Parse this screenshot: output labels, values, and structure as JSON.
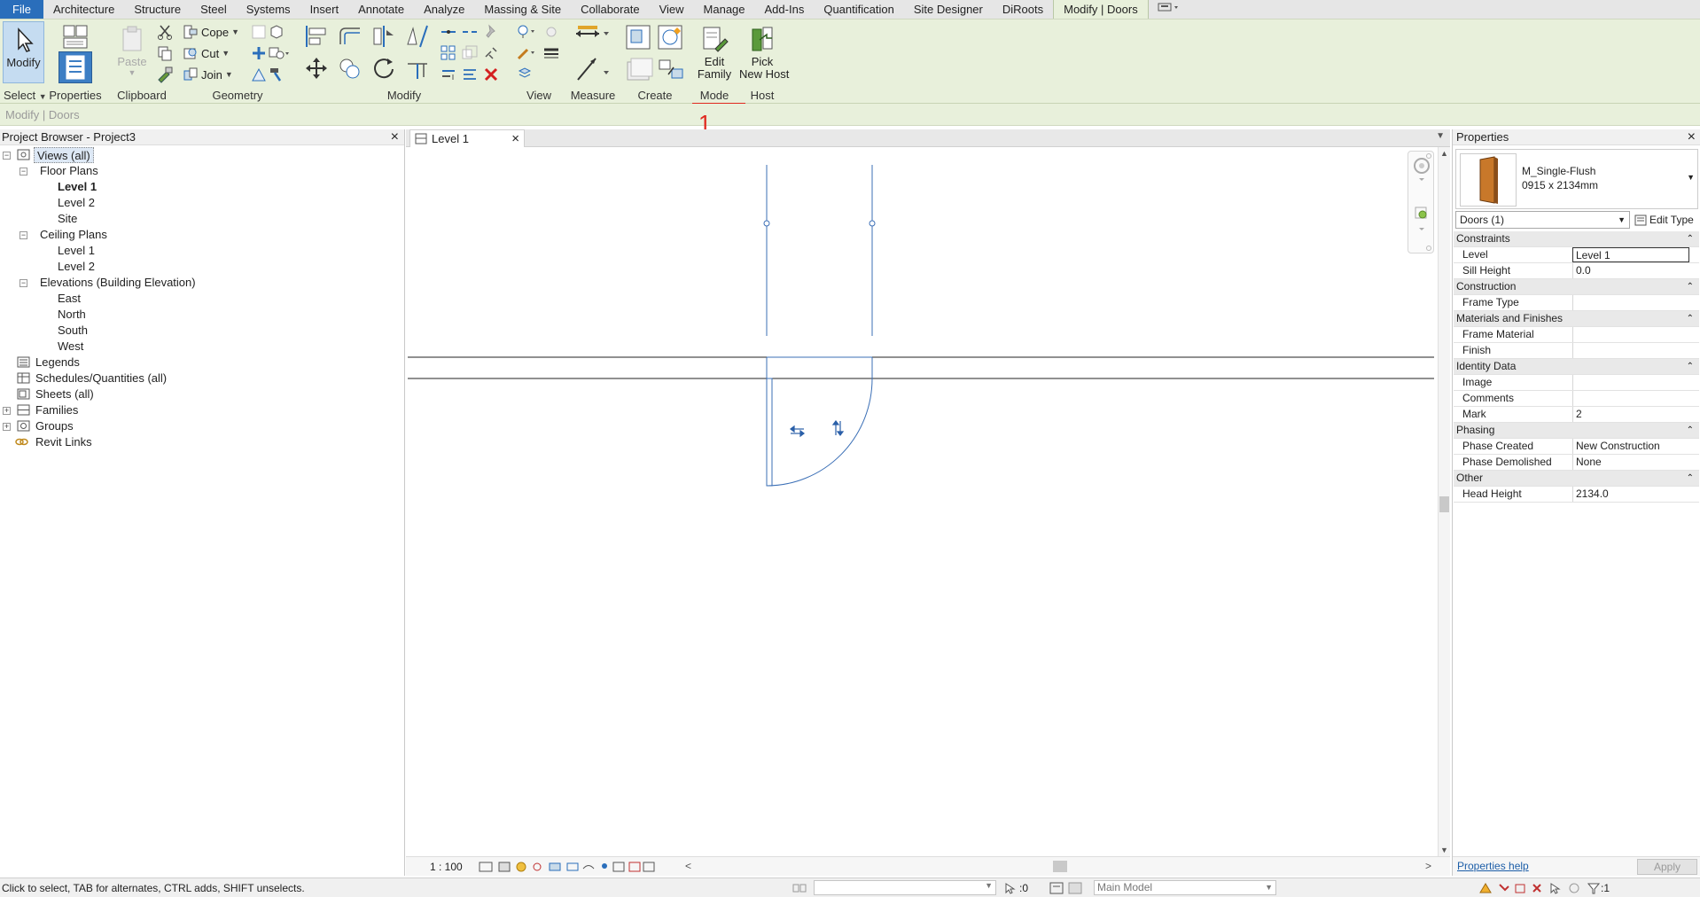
{
  "ribbon": {
    "tabs": [
      {
        "label": "File"
      },
      {
        "label": "Architecture"
      },
      {
        "label": "Structure"
      },
      {
        "label": "Steel"
      },
      {
        "label": "Systems"
      },
      {
        "label": "Insert"
      },
      {
        "label": "Annotate"
      },
      {
        "label": "Analyze"
      },
      {
        "label": "Massing & Site"
      },
      {
        "label": "Collaborate"
      },
      {
        "label": "View"
      },
      {
        "label": "Manage"
      },
      {
        "label": "Add-Ins"
      },
      {
        "label": "Quantification"
      },
      {
        "label": "Site Designer"
      },
      {
        "label": "DiRoots"
      },
      {
        "label": "Modify | Doors"
      }
    ],
    "active_tab": "Modify | Doors",
    "panels": {
      "select": "Select",
      "properties": "Properties",
      "clipboard": "Clipboard",
      "geometry": "Geometry",
      "modify": "Modify",
      "view": "View",
      "measure": "Measure",
      "create": "Create",
      "mode": "Mode",
      "host": "Host"
    },
    "buttons": {
      "modify": "Modify",
      "paste": "Paste",
      "cope": "Cope",
      "cut": "Cut",
      "join": "Join",
      "edit_family_1": "Edit",
      "edit_family_2": "Family",
      "pick_host_1": "Pick",
      "pick_host_2": "New Host"
    },
    "annotation_number": "1",
    "annotation_color": "#e0281e"
  },
  "options_bar": {
    "text": "Modify | Doors"
  },
  "project_browser": {
    "title": "Project Browser - Project3",
    "items": [
      {
        "label": "Views (all)"
      },
      {
        "label": "Floor Plans"
      },
      {
        "label": "Level 1"
      },
      {
        "label": "Level 2"
      },
      {
        "label": "Site"
      },
      {
        "label": "Ceiling Plans"
      },
      {
        "label": "Level 1"
      },
      {
        "label": "Level 2"
      },
      {
        "label": "Elevations (Building Elevation)"
      },
      {
        "label": "East"
      },
      {
        "label": "North"
      },
      {
        "label": "South"
      },
      {
        "label": "West"
      },
      {
        "label": "Legends"
      },
      {
        "label": "Schedules/Quantities (all)"
      },
      {
        "label": "Sheets (all)"
      },
      {
        "label": "Families"
      },
      {
        "label": "Groups"
      },
      {
        "label": "Revit Links"
      }
    ]
  },
  "view": {
    "tab_label": "Level 1",
    "scale": "1 : 100",
    "selection_color": "#3b6fb6"
  },
  "properties": {
    "title": "Properties",
    "type_name": "M_Single-Flush",
    "type_size": "0915 x 2134mm",
    "instance_selector": "Doors (1)",
    "edit_type": "Edit Type",
    "groups": [
      {
        "name": "Constraints",
        "rows": [
          {
            "name": "Level",
            "value": "Level 1"
          },
          {
            "name": "Sill Height",
            "value": "0.0"
          }
        ]
      },
      {
        "name": "Construction",
        "rows": [
          {
            "name": "Frame Type",
            "value": ""
          }
        ]
      },
      {
        "name": "Materials and Finishes",
        "rows": [
          {
            "name": "Frame Material",
            "value": ""
          },
          {
            "name": "Finish",
            "value": ""
          }
        ]
      },
      {
        "name": "Identity Data",
        "rows": [
          {
            "name": "Image",
            "value": ""
          },
          {
            "name": "Comments",
            "value": ""
          },
          {
            "name": "Mark",
            "value": "2"
          }
        ]
      },
      {
        "name": "Phasing",
        "rows": [
          {
            "name": "Phase Created",
            "value": "New Construction"
          },
          {
            "name": "Phase Demolished",
            "value": "None"
          }
        ]
      },
      {
        "name": "Other",
        "rows": [
          {
            "name": "Head Height",
            "value": "2134.0"
          }
        ]
      }
    ],
    "help_link": "Properties help",
    "apply_button": "Apply"
  },
  "status_bar": {
    "message": "Click to select, TAB for alternates, CTRL adds, SHIFT unselects.",
    "select_count": ":0",
    "model": "Main Model",
    "filter_count": ":1"
  }
}
